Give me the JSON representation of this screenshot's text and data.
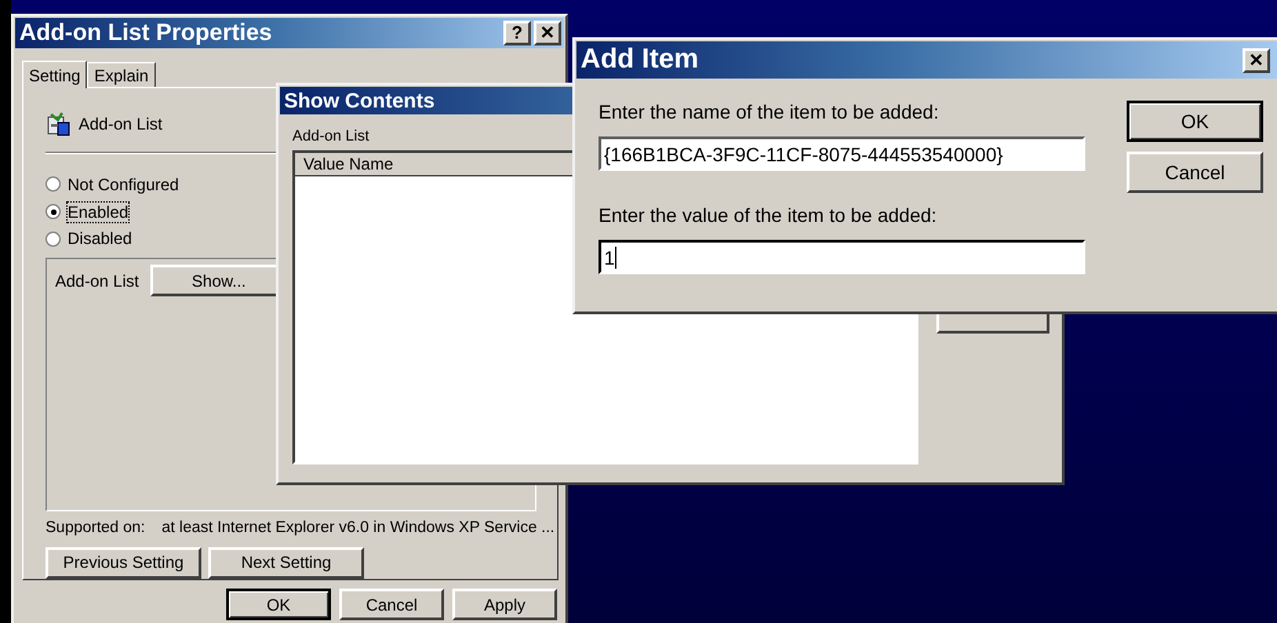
{
  "properties_dialog": {
    "title": "Add-on List Properties",
    "title_buttons": [
      "?",
      "✕"
    ],
    "tabs": [
      {
        "label": "Setting",
        "selected": true
      },
      {
        "label": "Explain",
        "selected": false
      }
    ],
    "policy_name": "Add-on List",
    "options": [
      {
        "label": "Not Configured",
        "selected": false
      },
      {
        "label": "Enabled",
        "selected": true
      },
      {
        "label": "Disabled",
        "selected": false
      }
    ],
    "group": {
      "label": "Add-on List",
      "button": "Show..."
    },
    "supported_on": {
      "label": "Supported on:",
      "value": "at least Internet Explorer v6.0 in Windows XP Service ..."
    },
    "nav_buttons": [
      "Previous Setting",
      "Next Setting"
    ],
    "buttons": [
      "OK",
      "Cancel",
      "Apply"
    ]
  },
  "show_contents": {
    "title": "Show Contents",
    "list_label": "Add-on List",
    "columns": [
      "Value Name"
    ]
  },
  "add_item": {
    "title": "Add Item",
    "close": "✕",
    "fields": [
      {
        "label": "Enter the name of the item to be added:",
        "value": "{166B1BCA-3F9C-11CF-8075-444553540000}",
        "focused": false
      },
      {
        "label": "Enter the value of the item to be added:",
        "value": "1",
        "focused": true
      }
    ],
    "buttons": [
      {
        "label": "OK",
        "default": true
      },
      {
        "label": "Cancel",
        "default": false
      }
    ]
  }
}
